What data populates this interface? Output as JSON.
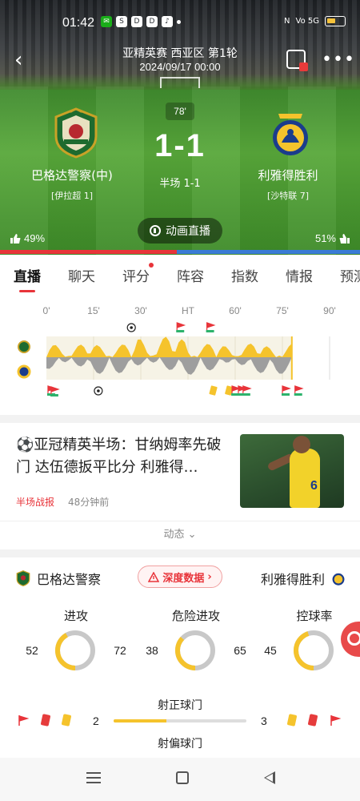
{
  "status_bar": {
    "time": "01:42",
    "signal_text": "Vo 5G",
    "battery_color": "#f6c23a"
  },
  "header": {
    "league": "亚精英赛 西亚区 第1轮",
    "datetime": "2024/09/17 00:00",
    "minute": "78'",
    "score": "1-1",
    "half_time": "半场 1-1",
    "home_team": "巴格达警察(中)",
    "home_league": "[伊拉超 1]",
    "away_team": "利雅得胜利",
    "away_league": "[沙特联 7]",
    "animation_button": "动画直播",
    "home_vote_pct": "49%",
    "away_vote_pct": "51%",
    "home_vote_value": 0.49
  },
  "tabs": [
    {
      "label": "直播",
      "active": true
    },
    {
      "label": "聊天"
    },
    {
      "label": "评分",
      "has_dot": true
    },
    {
      "label": "阵容"
    },
    {
      "label": "指数"
    },
    {
      "label": "情报"
    },
    {
      "label": "预测"
    }
  ],
  "momentum": {
    "ticks": [
      "0'",
      "15'",
      "30'",
      "HT",
      "60'",
      "75'",
      "90'"
    ],
    "current_minute": 78,
    "home_color": "#f5c32c",
    "away_color": "#9e9e9e"
  },
  "news": {
    "title": "⚽亚冠精英半场：甘纳姆率先破门 达伍德扳平比分 利雅得…",
    "tag": "半场战报",
    "time": "48分钟前",
    "player_number": "6"
  },
  "dynamic_label": "动态 ⌄",
  "stats": {
    "home_team": "巴格达警察",
    "away_team": "利雅得胜利",
    "deep_data_button": "深度数据",
    "rings": [
      {
        "label": "进攻",
        "home": 52,
        "away": 72
      },
      {
        "label": "危险进攻",
        "home": 38,
        "away": 65
      },
      {
        "label": "控球率",
        "home": 45,
        "away": 55
      }
    ],
    "shots_on": {
      "label": "射正球门",
      "home": 2,
      "away": 3
    },
    "shots_off": {
      "label": "射偏球门"
    },
    "accent_color": "#f5c32c"
  }
}
